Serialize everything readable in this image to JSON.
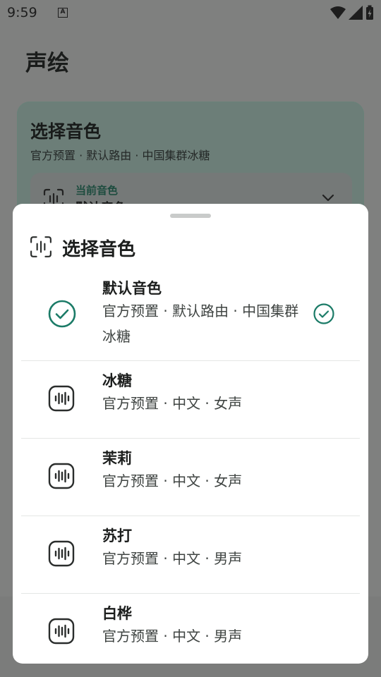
{
  "status_bar": {
    "time": "9:59",
    "notification_badge": "A"
  },
  "app": {
    "title": "声绘"
  },
  "card": {
    "title": "选择音色",
    "subtitle": "官方预置 · 默认路由 · 中国集群冰糖",
    "current_label": "当前音色",
    "current_value": "默认音色"
  },
  "sheet": {
    "title": "选择音色",
    "items": [
      {
        "name": "默认音色",
        "desc": "官方预置 · 默认路由 · 中国集群冰糖",
        "selected": true
      },
      {
        "name": "冰糖",
        "desc": "官方预置 · 中文 · 女声",
        "selected": false
      },
      {
        "name": "茉莉",
        "desc": "官方预置 · 中文 · 女声",
        "selected": false
      },
      {
        "name": "苏打",
        "desc": "官方预置 · 中文 · 男声",
        "selected": false
      },
      {
        "name": "白桦",
        "desc": "官方预置 · 中文 · 男声",
        "selected": false
      }
    ]
  },
  "colors": {
    "accent": "#1b7b67",
    "scrim": "#7f807f",
    "sheet_bg": "#ffffff"
  }
}
